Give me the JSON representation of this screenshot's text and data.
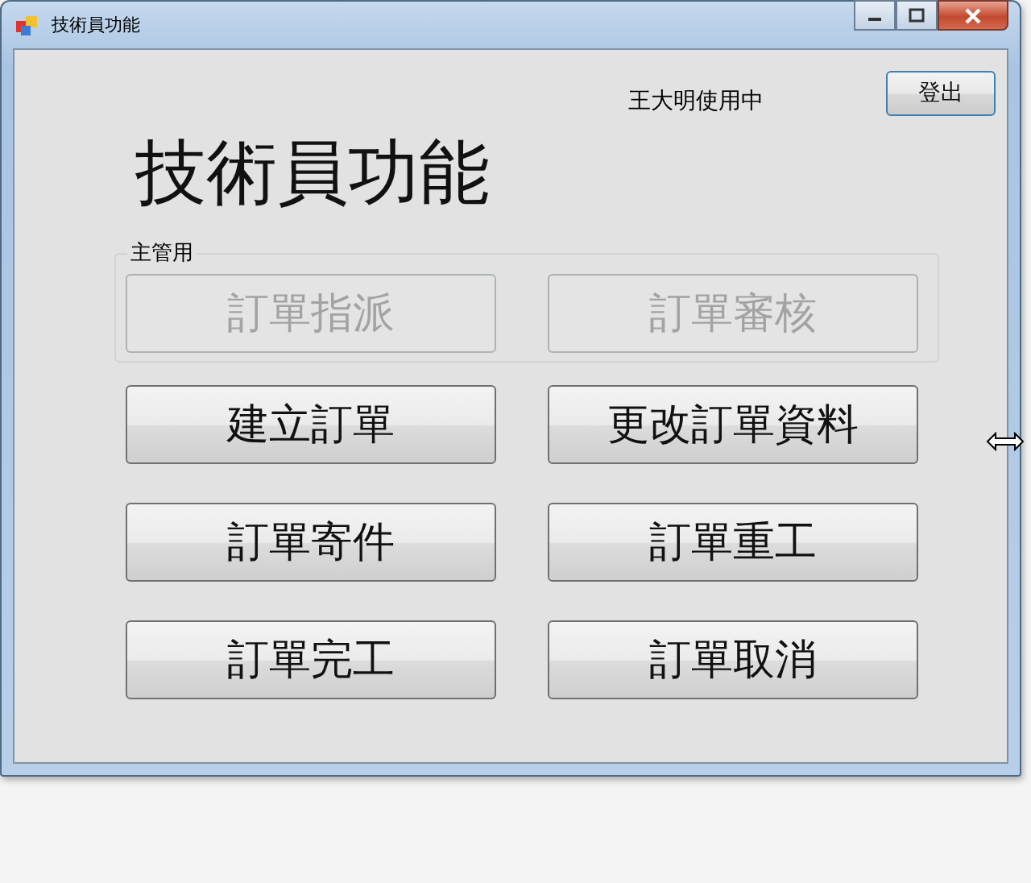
{
  "window": {
    "title": "技術員功能"
  },
  "user_status": "王大明使用中",
  "logout_button": {
    "label": "登出"
  },
  "heading": "技術員功能",
  "supervisor_group": {
    "label": "主管用",
    "buttons": [
      {
        "label": "訂單指派",
        "disabled": true
      },
      {
        "label": "訂單審核",
        "disabled": true
      }
    ]
  },
  "buttons": [
    {
      "label": "建立訂單",
      "disabled": false
    },
    {
      "label": "更改訂單資料",
      "disabled": false
    },
    {
      "label": "訂單寄件",
      "disabled": false
    },
    {
      "label": "訂單重工",
      "disabled": false
    },
    {
      "label": "訂單完工",
      "disabled": false
    },
    {
      "label": "訂單取消",
      "disabled": false
    }
  ]
}
